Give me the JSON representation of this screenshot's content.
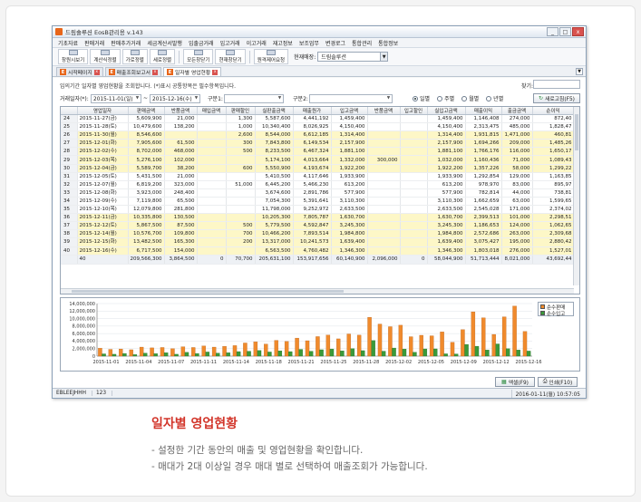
{
  "window": {
    "title": "드림솔루션 EosB관리용 v.143",
    "controls": [
      "_",
      "□",
      "x"
    ]
  },
  "menu": [
    "기초자료",
    "판매거래",
    "판매추가거래",
    "세금계산서발행",
    "입출금거래",
    "입고거래",
    "이고거래",
    "재고정보",
    "보조업무",
    "변경로그",
    "통합관리",
    "통합정보"
  ],
  "toolbar": {
    "buttons": [
      "창원시보기",
      "계산식정렬",
      "가로정렬",
      "세로정렬",
      "모든창닫기",
      "현재창닫기",
      "원격제어요청"
    ],
    "store_label": "현재매장:",
    "store_value": "드림솔루션"
  },
  "tabs": [
    {
      "label": "시작페이지"
    },
    {
      "label": "매출조회보고서"
    },
    {
      "label": "일자별 영업현황"
    }
  ],
  "page": {
    "description": "임의기간 일자별 영업현황을 조회합니다. (*)표시 공통항목은 필수항목입니다.",
    "search_label": "찾기:",
    "period_label": "거래일자(*):",
    "date_from": "2015-11-01(일)",
    "date_to": "2015-12-16(수)",
    "type1_label": "구분1:",
    "type2_label": "구분2:",
    "radios": [
      "일별",
      "주별",
      "월별",
      "년별"
    ],
    "selected_radio": "일별",
    "refresh_button": "새로고침(F5)",
    "excel_button": "엑셀(F9)",
    "print_button": "인쇄(F10)"
  },
  "grid": {
    "columns": [
      "",
      "영업일자",
      "판매금액",
      "반품금액",
      "매입금액",
      "판매할인",
      "실판출금액",
      "매출원가",
      "입고금액",
      "반품금액",
      "입고할인",
      "실입고금액",
      "매출이익",
      "출금금액",
      "순이익"
    ],
    "rows": [
      {
        "cells": [
          "24",
          "2015-11-27(금)",
          "5,609,900",
          "21,000",
          "",
          "1,300",
          "5,587,600",
          "4,441,192",
          "1,459,400",
          "",
          "",
          "1,459,400",
          "1,146,408",
          "274,000",
          "872,40"
        ],
        "hl": false
      },
      {
        "cells": [
          "25",
          "2015-11-28(토)",
          "10,479,600",
          "138,200",
          "",
          "1,000",
          "10,340,400",
          "8,026,925",
          "4,150,400",
          "",
          "",
          "4,150,400",
          "2,313,475",
          "485,000",
          "1,828,47"
        ],
        "hl": false
      },
      {
        "cells": [
          "26",
          "2015-11-30(월)",
          "8,546,600",
          "",
          "",
          "2,600",
          "8,544,000",
          "6,612,185",
          "1,314,400",
          "",
          "",
          "1,314,400",
          "1,931,815",
          "1,471,000",
          "460,81"
        ],
        "hl": true
      },
      {
        "cells": [
          "27",
          "2015-12-01(화)",
          "7,905,600",
          "61,500",
          "",
          "300",
          "7,843,800",
          "6,149,534",
          "2,157,900",
          "",
          "",
          "2,157,900",
          "1,694,266",
          "209,000",
          "1,485,26"
        ],
        "hl": true
      },
      {
        "cells": [
          "28",
          "2015-12-02(수)",
          "8,702,000",
          "468,000",
          "",
          "500",
          "8,233,500",
          "6,467,324",
          "1,881,100",
          "",
          "",
          "1,881,100",
          "1,766,176",
          "116,000",
          "1,650,17"
        ],
        "hl": true
      },
      {
        "cells": [
          "29",
          "2015-12-03(목)",
          "5,276,100",
          "102,000",
          "",
          "",
          "5,174,100",
          "4,013,664",
          "1,332,000",
          "300,000",
          "",
          "1,032,000",
          "1,160,436",
          "71,000",
          "1,089,43"
        ],
        "hl": true
      },
      {
        "cells": [
          "30",
          "2015-12-04(금)",
          "5,589,700",
          "38,200",
          "",
          "600",
          "5,550,900",
          "4,193,674",
          "1,922,200",
          "",
          "",
          "1,922,200",
          "1,357,226",
          "58,000",
          "1,299,22"
        ],
        "hl": true
      },
      {
        "cells": [
          "31",
          "2015-12-05(토)",
          "5,431,500",
          "21,000",
          "",
          "",
          "5,410,500",
          "4,117,646",
          "1,933,900",
          "",
          "",
          "1,933,900",
          "1,292,854",
          "129,000",
          "1,163,85"
        ],
        "hl": false
      },
      {
        "cells": [
          "32",
          "2015-12-07(월)",
          "6,819,200",
          "323,000",
          "",
          "51,000",
          "6,445,200",
          "5,466,230",
          "613,200",
          "",
          "",
          "613,200",
          "978,970",
          "83,000",
          "895,97"
        ],
        "hl": false
      },
      {
        "cells": [
          "33",
          "2015-12-08(화)",
          "3,923,000",
          "248,400",
          "",
          "",
          "3,674,600",
          "2,891,786",
          "577,900",
          "",
          "",
          "577,900",
          "782,814",
          "44,000",
          "738,81"
        ],
        "hl": false
      },
      {
        "cells": [
          "34",
          "2015-12-09(수)",
          "7,119,800",
          "65,500",
          "",
          "",
          "7,054,300",
          "5,391,641",
          "3,110,300",
          "",
          "",
          "3,110,300",
          "1,662,659",
          "63,000",
          "1,599,65"
        ],
        "hl": false
      },
      {
        "cells": [
          "35",
          "2015-12-10(목)",
          "12,079,800",
          "281,800",
          "",
          "",
          "11,798,000",
          "9,252,972",
          "2,633,500",
          "",
          "",
          "2,633,500",
          "2,545,028",
          "171,000",
          "2,374,02"
        ],
        "hl": false
      },
      {
        "cells": [
          "36",
          "2015-12-11(금)",
          "10,335,800",
          "130,500",
          "",
          "",
          "10,205,300",
          "7,805,787",
          "1,630,700",
          "",
          "",
          "1,630,700",
          "2,399,513",
          "101,000",
          "2,298,51"
        ],
        "hl": true
      },
      {
        "cells": [
          "37",
          "2015-12-12(토)",
          "5,867,500",
          "87,500",
          "",
          "500",
          "5,779,500",
          "4,592,847",
          "3,245,300",
          "",
          "",
          "3,245,300",
          "1,186,653",
          "124,000",
          "1,062,65"
        ],
        "hl": true
      },
      {
        "cells": [
          "38",
          "2015-12-14(월)",
          "10,576,700",
          "109,800",
          "",
          "700",
          "10,466,200",
          "7,893,514",
          "1,984,800",
          "",
          "",
          "1,984,800",
          "2,572,686",
          "263,000",
          "2,309,68"
        ],
        "hl": true
      },
      {
        "cells": [
          "39",
          "2015-12-15(화)",
          "13,482,500",
          "165,300",
          "",
          "200",
          "13,317,000",
          "10,241,573",
          "1,639,400",
          "",
          "",
          "1,639,400",
          "3,075,427",
          "195,000",
          "2,880,42"
        ],
        "hl": true
      },
      {
        "cells": [
          "40",
          "2015-12-16(수)",
          "6,717,500",
          "154,000",
          "",
          "",
          "6,563,500",
          "4,760,482",
          "1,346,300",
          "",
          "",
          "1,346,300",
          "1,803,018",
          "276,000",
          "1,527,01"
        ],
        "hl": true
      }
    ],
    "summary": [
      "",
      "40",
      "209,566,300",
      "3,864,500",
      "0",
      "70,700",
      "205,631,100",
      "153,917,656",
      "60,140,900",
      "2,096,000",
      "0",
      "58,044,900",
      "51,713,444",
      "8,021,000",
      "43,692,44"
    ]
  },
  "chart_data": {
    "type": "bar",
    "ylim": [
      0,
      14000000
    ],
    "y_ticks": [
      "14,000,000",
      "12,000,000",
      "10,000,000",
      "8,000,000",
      "6,000,000",
      "4,000,000",
      "2,000,000",
      "0"
    ],
    "x_tick_labels": [
      "2015-11-01",
      "2015-11-04",
      "2015-11-07",
      "2015-11-11",
      "2015-11-14",
      "2015-11-18",
      "2015-11-21",
      "2015-11-25",
      "2015-11-28",
      "2015-12-02",
      "2015-12-05",
      "2015-12-09",
      "2015-12-12",
      "2015-12-16"
    ],
    "series": [
      {
        "name": "순수판매",
        "color": "#f08a2c",
        "values": [
          2100000,
          1800000,
          1900000,
          1700000,
          2400000,
          2200000,
          2300000,
          2000000,
          2500000,
          2300000,
          2700000,
          2400000,
          2600000,
          2800000,
          3500000,
          3800000,
          3200000,
          4200000,
          3900000,
          4800000,
          4100000,
          5200000,
          5600000,
          4600000,
          5900000,
          5587600,
          10340400,
          8544000,
          7843800,
          8233500,
          5174100,
          5550900,
          5410500,
          6445200,
          3674600,
          7054300,
          11798000,
          10205300,
          5779500,
          10466200,
          13317000,
          6563500
        ]
      },
      {
        "name": "순수입고",
        "color": "#3a9a3a",
        "values": [
          600000,
          500000,
          700000,
          400000,
          800000,
          650000,
          900000,
          500000,
          1000000,
          700000,
          1100000,
          800000,
          900000,
          1200000,
          1300000,
          1500000,
          1100000,
          1400000,
          1200000,
          1800000,
          1300000,
          1700000,
          1900000,
          1400000,
          2000000,
          1459400,
          4150400,
          1314400,
          2157900,
          1881100,
          1032000,
          1922200,
          1933900,
          613200,
          577900,
          3110300,
          2633500,
          1630700,
          3245300,
          1984800,
          1639400,
          1346300
        ]
      }
    ]
  },
  "status": {
    "user": "EBLEEJHHH",
    "code": "123",
    "datetime": "2016-01-11(월) 10:57:05"
  },
  "caption": {
    "heading": "일자별 영업현황",
    "bullets": [
      "- 설정한 기간 동안의 매출 및 영업현황을 확인합니다.",
      "- 매대가 2대 이상일 경우 매대 별로 선택하여 매출조회가 가능합니다."
    ]
  },
  "colors": {
    "accent": "#e8661a",
    "heading": "#d2352a",
    "highlight_row": "#fdf7c7"
  }
}
